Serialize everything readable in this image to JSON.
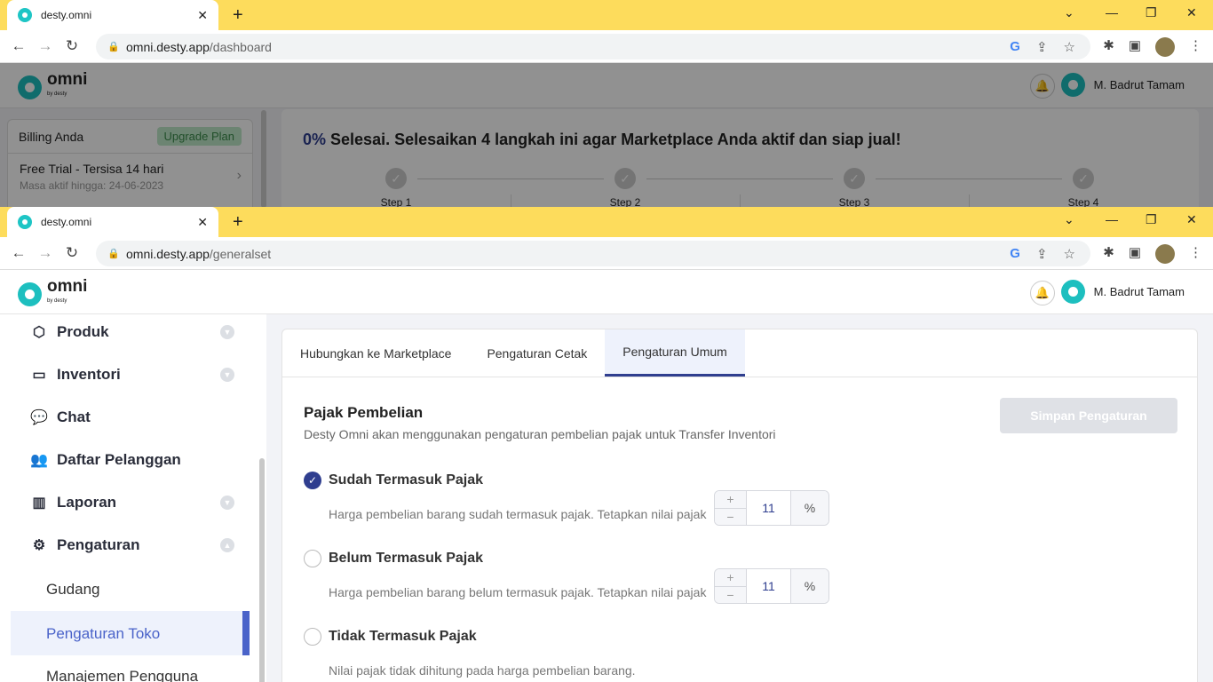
{
  "back_window": {
    "tab_title": "desty.omni",
    "url_host": "omni.desty.app",
    "url_path": "/dashboard",
    "user": "M. Badrut Tamam",
    "logo": "omni",
    "logo_sub": "by desty",
    "billing": {
      "title": "Billing Anda",
      "upgrade": "Upgrade Plan",
      "plan": "Free Trial - Tersisa 14 hari",
      "expiry": "Masa aktif hingga: 24-06-2023"
    },
    "progress": {
      "percent": "0%",
      "text": "Selesai. Selesaikan 4 langkah ini agar Marketplace Anda aktif dan siap jual!",
      "steps": [
        "Step 1",
        "Step 2",
        "Step 3",
        "Step 4"
      ]
    }
  },
  "front_window": {
    "tab_title": "desty.omni",
    "url_host": "omni.desty.app",
    "url_path": "/generalset",
    "user": "M. Badrut Tamam",
    "logo": "omni",
    "logo_sub": "by desty",
    "sidebar": [
      {
        "label": "Produk"
      },
      {
        "label": "Inventori"
      },
      {
        "label": "Chat"
      },
      {
        "label": "Daftar Pelanggan"
      },
      {
        "label": "Laporan"
      },
      {
        "label": "Pengaturan"
      }
    ],
    "sub_items": [
      "Gudang",
      "Pengaturan Toko",
      "Manajemen Pengguna"
    ],
    "tabs": [
      "Hubungkan ke Marketplace",
      "Pengaturan Cetak",
      "Pengaturan Umum"
    ],
    "section": {
      "title": "Pajak Pembelian",
      "desc": "Desty Omni akan menggunakan pengaturan pembelian pajak untuk Transfer Inventori",
      "save": "Simpan Pengaturan"
    },
    "options": [
      {
        "label": "Sudah Termasuk Pajak",
        "desc": "Harga pembelian barang sudah termasuk pajak. Tetapkan nilai pajak",
        "value": "11",
        "unit": "%",
        "checked": true
      },
      {
        "label": "Belum Termasuk Pajak",
        "desc": "Harga pembelian barang belum termasuk pajak. Tetapkan nilai pajak",
        "value": "11",
        "unit": "%",
        "checked": false
      },
      {
        "label": "Tidak Termasuk Pajak",
        "desc": "Nilai pajak tidak dihitung pada harga pembelian barang.",
        "checked": false
      }
    ]
  },
  "colors": {
    "accent": "#2f3e8f",
    "teal": "#1dbfbf",
    "tabbar": "#fddc5c"
  }
}
